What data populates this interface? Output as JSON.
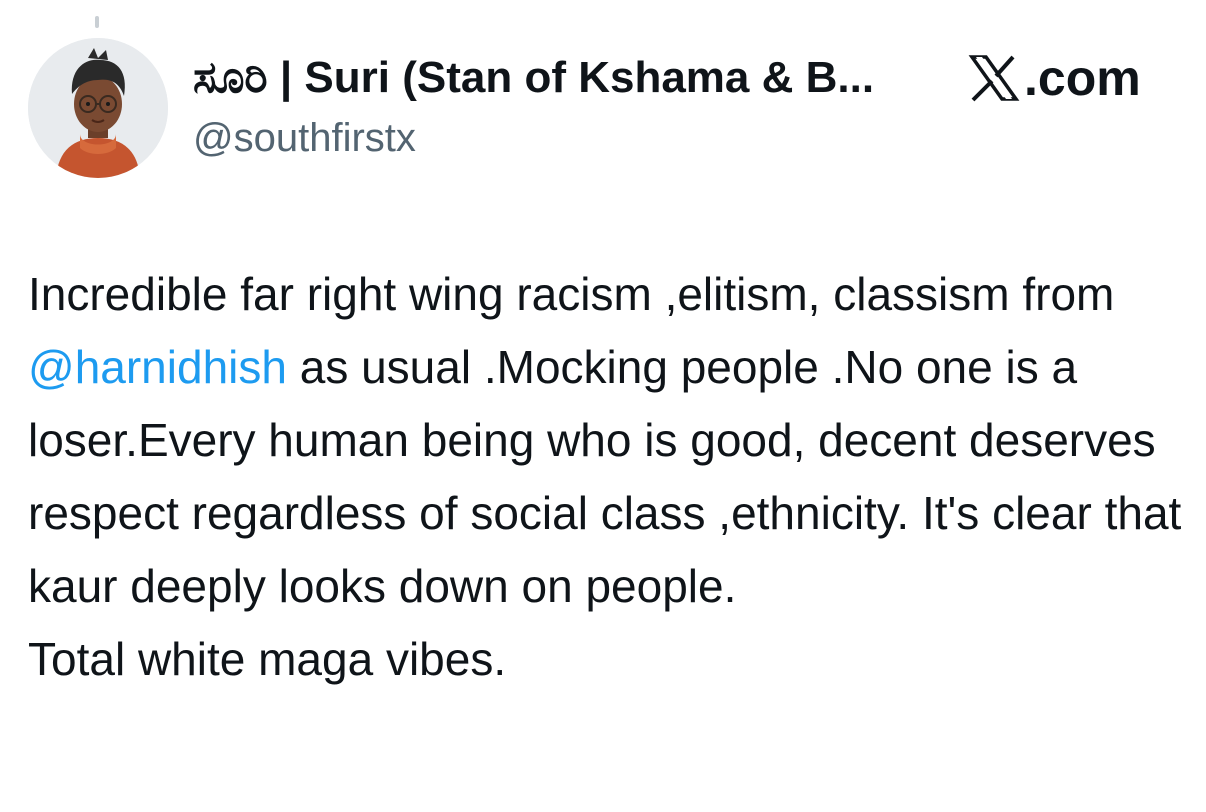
{
  "author": {
    "display_name": "ಸೂರಿ | Suri (Stan of Kshama & B...",
    "handle": "@southfirstx",
    "avatar_icon": "avatar-illustration"
  },
  "brand": {
    "logo_icon": "x-logo-icon",
    "label": ".com"
  },
  "tweet": {
    "part1": "Incredible far right wing racism ,elitism, classism from ",
    "mention": "@harnidhish",
    "part2": " as usual .Mocking people .No one is a loser.Every human being who is good, decent deserves respect regardless of social class ,ethnicity. It's clear that kaur deeply looks down on people.",
    "part3": "Total white maga vibes."
  },
  "colors": {
    "text": "#0f1419",
    "secondary": "#536471",
    "mention": "#1d9bf0"
  }
}
